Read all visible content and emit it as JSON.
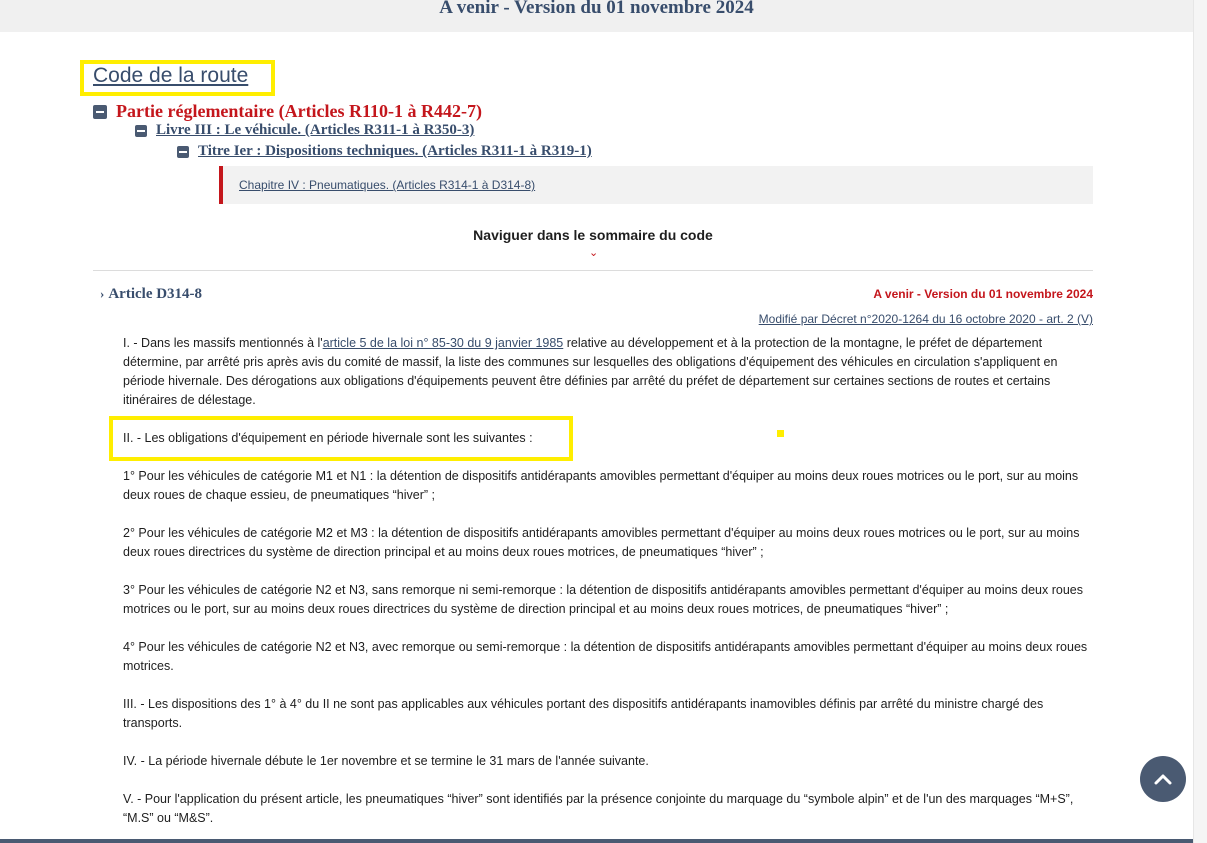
{
  "header": {
    "banner": "A venir - Version du 01 novembre 2024"
  },
  "code": {
    "title": "Code de la route"
  },
  "tree": {
    "partie": "Partie réglementaire (Articles R110-1 à R442-7)",
    "livre": "Livre III : Le véhicule. (Articles R311-1 à R350-3)",
    "titre": "Titre Ier : Dispositions techniques. (Articles R311-1 à R319-1)",
    "chapitre": "Chapitre IV : Pneumatiques. (Articles R314-1 à D314-8)"
  },
  "nav": {
    "label": "Naviguer dans le sommaire du code",
    "chevron": "⌄"
  },
  "article": {
    "chevron": "›",
    "title": "Article D314-8",
    "version": "A venir - Version du 01 novembre 2024",
    "modified_by": "Modifié par Décret n°2020-1264 du 16 octobre 2020 - art. 2 (V)",
    "p1_before": "I. - Dans les massifs mentionnés à l'",
    "p1_link": "article 5 de la loi n° 85-30 du 9 janvier 1985",
    "p1_after": " relative au développement et à la protection de la montagne, le préfet de département détermine, par arrêté pris après avis du comité de massif, la liste des communes sur lesquelles des obligations d'équipement des véhicules en circulation s'appliquent en période hivernale. Des dérogations aux obligations d'équipements peuvent être définies par arrêté du préfet de département sur certaines sections de routes et certains itinéraires de délestage.",
    "p2": "II. - Les obligations d'équipement en période hivernale sont les suivantes :",
    "p3": "1° Pour les véhicules de catégorie M1 et N1 : la détention de dispositifs antidérapants amovibles permettant d'équiper au moins deux roues motrices ou le port, sur au moins deux roues de chaque essieu, de pneumatiques “hiver” ;",
    "p4": "2° Pour les véhicules de catégorie M2 et M3 : la détention de dispositifs antidérapants amovibles permettant d'équiper au moins deux roues motrices ou le port, sur au moins deux roues directrices du système de direction principal et au moins deux roues motrices, de pneumatiques “hiver” ;",
    "p5": "3° Pour les véhicules de catégorie N2 et N3, sans remorque ni semi-remorque : la détention de dispositifs antidérapants amovibles permettant d'équiper au moins deux roues motrices ou le port, sur au moins deux roues directrices du système de direction principal et au moins deux roues motrices, de pneumatiques “hiver” ;",
    "p6": "4° Pour les véhicules de catégorie N2 et N3, avec remorque ou semi-remorque : la détention de dispositifs antidérapants amovibles permettant d'équiper au moins deux roues motrices.",
    "p7": "III. - Les dispositions des 1° à 4° du II ne sont pas applicables aux véhicules portant des dispositifs antidérapants inamovibles définis par arrêté du ministre chargé des transports.",
    "p8": "IV. - La période hivernale débute le 1er novembre et se termine le 31 mars de l'année suivante.",
    "p9": "V. - Pour l'application du présent article, les pneumatiques “hiver” sont identifiés par la présence conjointe du marquage du “symbole alpin” et de l'un des marquages “M+S”, “M.S” ou “M&S”."
  },
  "icons": {
    "collapse": "minus-square-icon",
    "scroll_top": "arrow-up-icon"
  },
  "colors": {
    "navy": "#384d6c",
    "red": "#c4161c",
    "highlight": "#ffee00"
  }
}
